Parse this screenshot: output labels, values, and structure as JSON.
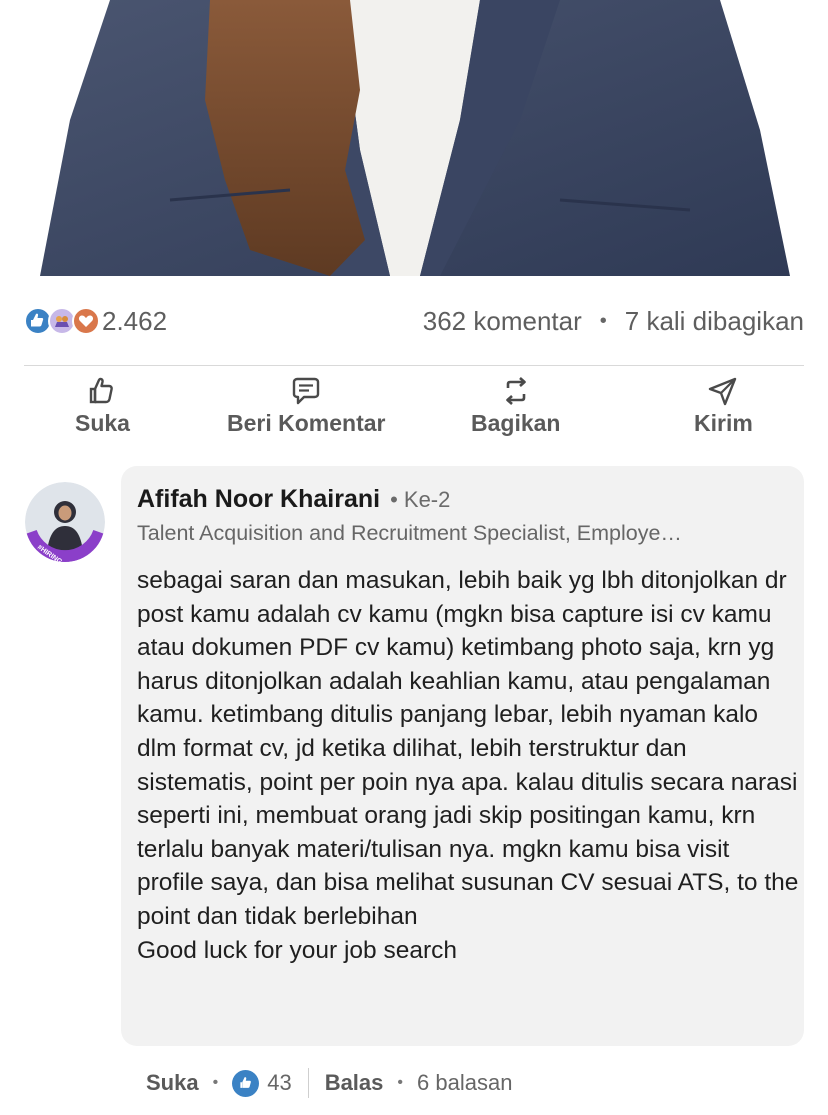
{
  "post": {
    "reaction_icons": [
      "like-icon",
      "celebrate-icon",
      "love-icon"
    ],
    "reaction_count": "2.462",
    "comment_count": "362 komentar",
    "share_count": "7 kali dibagikan"
  },
  "actions": [
    {
      "label": "Suka",
      "icon": "like-icon"
    },
    {
      "label": "Beri Komentar",
      "icon": "comment-icon"
    },
    {
      "label": "Bagikan",
      "icon": "repost-icon"
    },
    {
      "label": "Kirim",
      "icon": "send-icon"
    }
  ],
  "comment": {
    "author": "Afifah Noor Khairani",
    "degree": "• Ke-2",
    "headline": "Talent Acquisition and Recruitment Specialist, Employe…",
    "avatar_badge": "#HIRING",
    "text": "sebagai saran dan masukan, lebih baik yg lbh ditonjolkan dr post kamu adalah cv kamu (mgkn bisa capture isi cv kamu atau dokumen PDF cv kamu) ketimbang photo saja, krn yg harus ditonjolkan adalah keahlian kamu, atau pengalaman kamu. ketimbang ditulis panjang lebar, lebih nyaman kalo dlm format cv, jd ketika dilihat, lebih terstruktur dan sistematis, point per poin nya apa. kalau ditulis secara narasi seperti ini, membuat orang jadi skip positingan kamu, krn terlalu banyak materi/tulisan nya. mgkn kamu bisa visit profile saya, dan bisa melihat susunan CV sesuai ATS, to the point dan tidak berlebihan\nGood luck for your job search",
    "like_label": "Suka",
    "like_count": "43",
    "reply_label": "Balas",
    "reply_count": "6 balasan"
  },
  "colors": {
    "accent_blue": "#3b82c4",
    "bubble_bg": "#f2f2f2",
    "muted_text": "#666666",
    "avatar_ring": "#8b3fc9"
  }
}
